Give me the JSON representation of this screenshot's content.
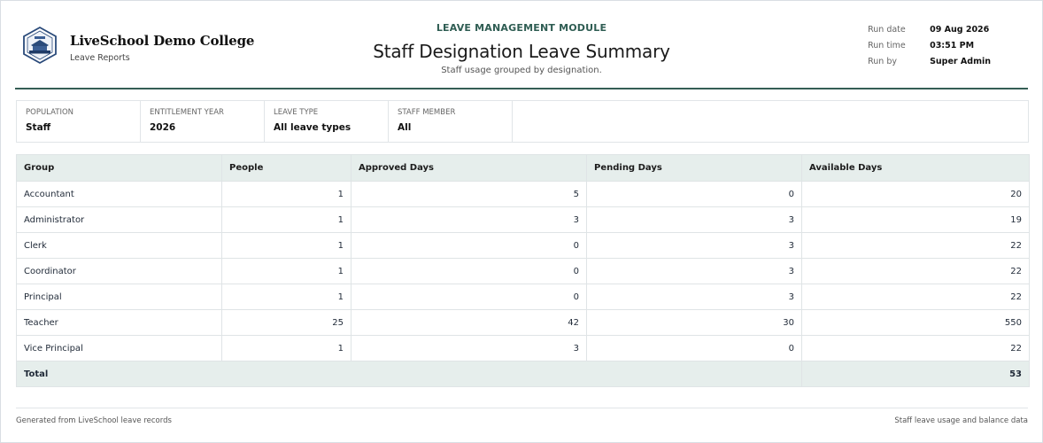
{
  "brand": {
    "name": "LiveSchool Demo College",
    "sub": "Leave Reports"
  },
  "report": {
    "module": "LEAVE MANAGEMENT MODULE",
    "title": "Staff Designation Leave Summary",
    "subtitle": "Staff usage grouped by designation."
  },
  "meta": [
    {
      "label": "Run date",
      "value": "09 Aug 2026"
    },
    {
      "label": "Run time",
      "value": "03:51 PM"
    },
    {
      "label": "Run by",
      "value": "Super Admin"
    }
  ],
  "filters": [
    {
      "label": "POPULATION",
      "value": "Staff"
    },
    {
      "label": "ENTITLEMENT YEAR",
      "value": "2026"
    },
    {
      "label": "LEAVE TYPE",
      "value": "All leave types"
    },
    {
      "label": "STAFF MEMBER",
      "value": "All"
    }
  ],
  "table": {
    "headers": [
      "Group",
      "People",
      "Approved Days",
      "Pending Days",
      "Available Days"
    ],
    "rows": [
      [
        "Accountant",
        "1",
        "5",
        "0",
        "20"
      ],
      [
        "Administrator",
        "1",
        "3",
        "3",
        "19"
      ],
      [
        "Clerk",
        "1",
        "0",
        "3",
        "22"
      ],
      [
        "Coordinator",
        "1",
        "0",
        "3",
        "22"
      ],
      [
        "Principal",
        "1",
        "0",
        "3",
        "22"
      ],
      [
        "Teacher",
        "25",
        "42",
        "30",
        "550"
      ],
      [
        "Vice Principal",
        "1",
        "3",
        "0",
        "22"
      ]
    ],
    "total_label": "Total",
    "total_value": "53"
  },
  "footer": {
    "left": "Generated from LiveSchool leave records",
    "right": "Staff leave usage and balance data"
  },
  "colors": {
    "accent": "#2f5d53",
    "header_fill": "#e6eeec"
  }
}
